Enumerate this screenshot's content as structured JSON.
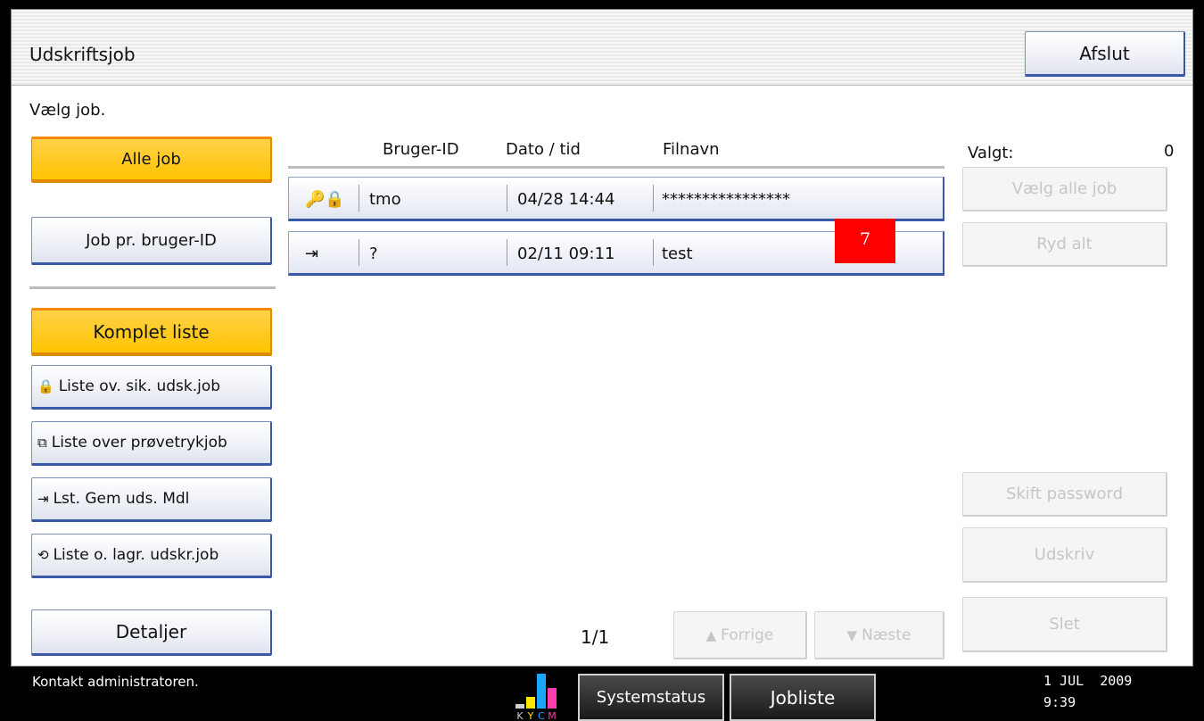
{
  "window": {
    "title": "Udskriftsjob",
    "exit_label": "Afslut"
  },
  "prompt": "Vælg job.",
  "filter_buttons": {
    "all_jobs": "Alle job",
    "by_user": "Job pr. bruger-ID"
  },
  "list_buttons": {
    "complete": "Komplet liste",
    "secure": "Liste ov. sik. udsk.job",
    "sample": "Liste over prøvetrykjob",
    "hold": "Lst. Gem uds. Mdl",
    "stored": "Liste o. lagr. udskr.job"
  },
  "details_label": "Detaljer",
  "table": {
    "headers": {
      "user_id": "Bruger-ID",
      "datetime": "Dato / tid",
      "filename": "Filnavn"
    },
    "rows": [
      {
        "icons": "🔒-lock",
        "user": "tmo",
        "datetime": "04/28 14:44",
        "filename": "****************"
      },
      {
        "icons": "hold-print",
        "user": "?",
        "datetime": "02/11 09:11",
        "filename": "test"
      }
    ]
  },
  "badge": "7",
  "selection": {
    "label": "Valgt:",
    "count": "0"
  },
  "actions": {
    "select_all": "Vælg alle job",
    "clear_all": "Ryd alt",
    "change_password": "Skift password",
    "print": "Udskriv",
    "delete": "Slet"
  },
  "pager": {
    "page": "1/1",
    "prev": "Forrige",
    "next": "Næste"
  },
  "statusbar": {
    "message": "Kontakt administratoren.",
    "system_status": "Systemstatus",
    "job_list": "Jobliste",
    "date": "1 JUL  2009",
    "time": "9:39",
    "toner_labels": [
      "K",
      "Y",
      "C",
      "M"
    ]
  },
  "colors": {
    "selected": "#ffc400",
    "button_border": "#3a58a8",
    "badge": "#ff0000"
  }
}
